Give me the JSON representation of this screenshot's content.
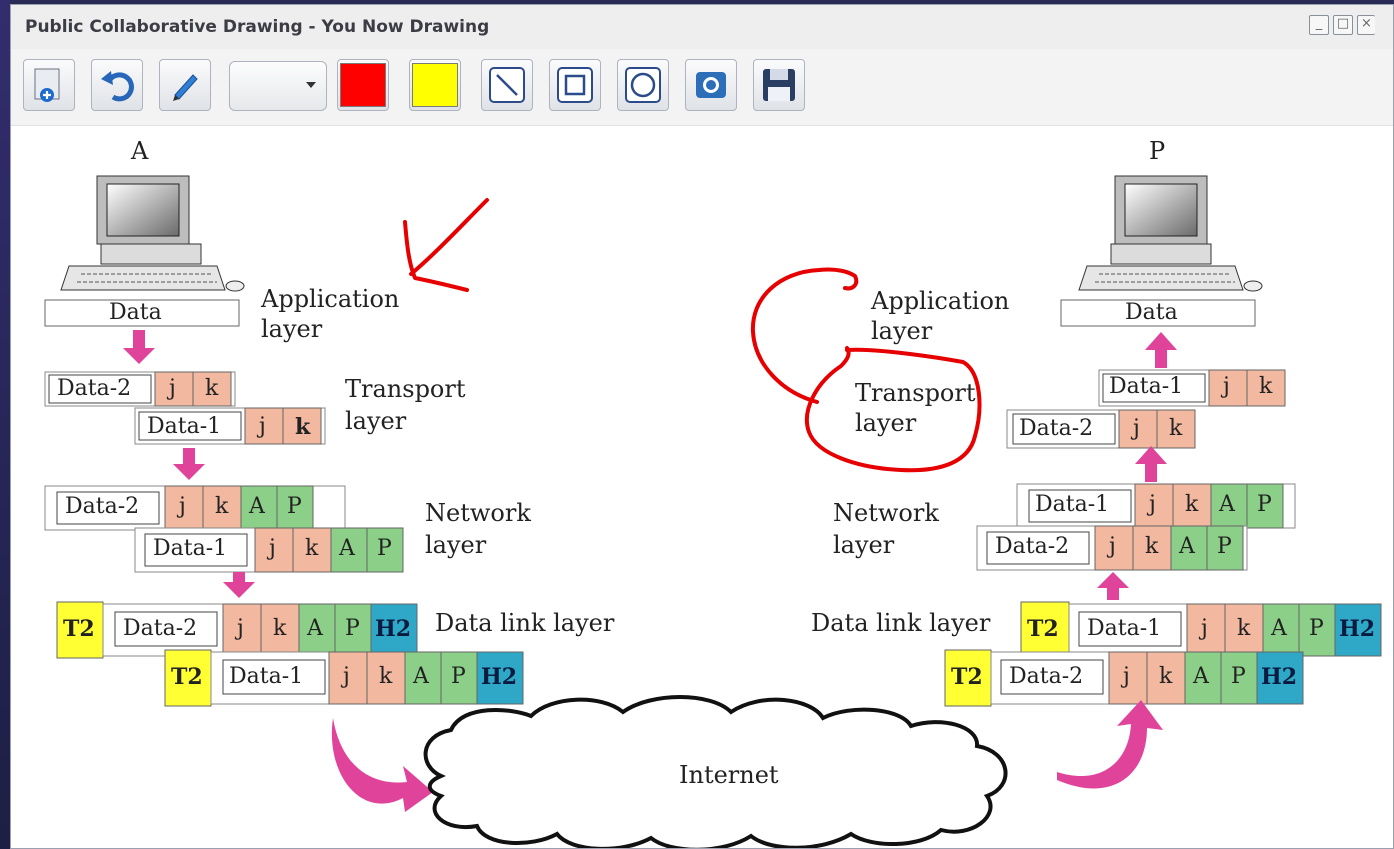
{
  "window": {
    "title": "Public Collaborative Drawing - You Now Drawing",
    "controls": [
      "minimize",
      "maximize",
      "close"
    ]
  },
  "toolbar": {
    "buttons": [
      {
        "name": "new-icon"
      },
      {
        "name": "undo-icon"
      },
      {
        "name": "pencil-icon"
      },
      {
        "name": "stroke-width-dropdown"
      },
      {
        "name": "color-red",
        "color": "#ff0000"
      },
      {
        "name": "color-yellow",
        "color": "#ffff00"
      },
      {
        "name": "line-tool-icon"
      },
      {
        "name": "rectangle-tool-icon"
      },
      {
        "name": "circle-tool-icon"
      },
      {
        "name": "camera-icon"
      },
      {
        "name": "save-icon"
      }
    ]
  },
  "diagram": {
    "host_a": "A",
    "host_p": "P",
    "data": "Data",
    "left_layers": {
      "application": [
        "Application",
        "layer"
      ],
      "transport": [
        "Transport",
        "layer"
      ],
      "network": [
        "Network",
        "layer"
      ],
      "datalink": "Data link layer"
    },
    "right_layers": {
      "application": [
        "Application",
        "layer"
      ],
      "transport": [
        "Transport",
        "layer"
      ],
      "network": [
        "Network",
        "layer"
      ],
      "datalink": "Data link layer"
    },
    "cloud": "Internet",
    "fields": {
      "d1": "Data-1",
      "d2": "Data-2",
      "j": "j",
      "k": "k",
      "a": "A",
      "p": "P",
      "h2": "H2",
      "t2": "T2"
    },
    "colors": {
      "salmon": "#f2b8a0",
      "green": "#8ccf88",
      "blue": "#2ea8c6",
      "yellow": "#ffff33",
      "pink": "#e0449a",
      "annotation": "#e60000"
    }
  }
}
